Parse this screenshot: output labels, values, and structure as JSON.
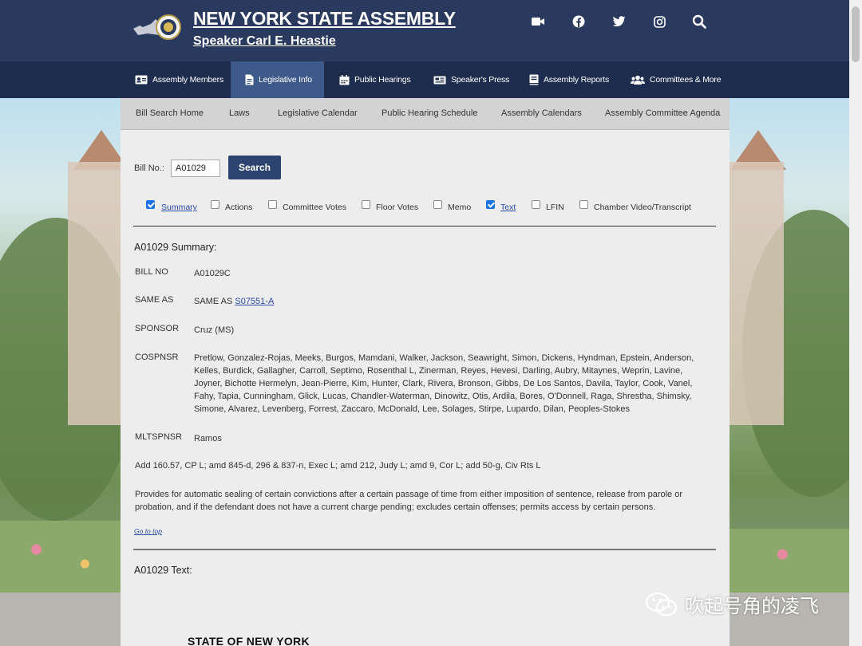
{
  "header": {
    "title": "NEW YORK STATE ASSEMBLY",
    "subtitle": "Speaker Carl E. Heastie",
    "social_icons": [
      "video-icon",
      "facebook-icon",
      "twitter-icon",
      "instagram-icon",
      "search-icon"
    ]
  },
  "nav": {
    "items": [
      {
        "label": "Assembly Members",
        "icon": "id-card-icon"
      },
      {
        "label": "Legislative Info",
        "icon": "document-icon",
        "active": true
      },
      {
        "label": "Public Hearings",
        "icon": "calendar-icon"
      },
      {
        "label": "Speaker's Press",
        "icon": "newspaper-icon"
      },
      {
        "label": "Assembly Reports",
        "icon": "book-icon"
      },
      {
        "label": "Committees & More",
        "icon": "users-icon"
      }
    ]
  },
  "subnav": {
    "items": [
      "Bill Search Home",
      "Laws",
      "Legislative Calendar",
      "Public Hearing Schedule",
      "Assembly Calendars",
      "Assembly Committee Agenda"
    ]
  },
  "search": {
    "label": "Bill No.:",
    "value": "A01029",
    "button": "Search"
  },
  "options": [
    {
      "label": "Summary",
      "checked": true,
      "link": true
    },
    {
      "label": "Actions",
      "checked": false
    },
    {
      "label": "Committee Votes",
      "checked": false
    },
    {
      "label": "Floor Votes",
      "checked": false
    },
    {
      "label": "Memo",
      "checked": false
    },
    {
      "label": "Text",
      "checked": true,
      "link": true
    },
    {
      "label": "LFIN",
      "checked": false
    },
    {
      "label": "Chamber Video/Transcript",
      "checked": false
    }
  ],
  "summary": {
    "heading": "A01029 Summary:",
    "fields": {
      "bill_no_label": "BILL NO",
      "bill_no": "A01029C",
      "same_as_label": "SAME AS",
      "same_as_prefix": "SAME AS",
      "same_as_link": "S07551-A",
      "sponsor_label": "SPONSOR",
      "sponsor": "Cruz (MS)",
      "cosponsor_label": "COSPNSR",
      "cosponsor_lines": [
        "Pretlow, Gonzalez-Rojas, Meeks, Burgos, Mamdani, Walker, Jackson, Seawright, Simon, Dickens, Hyndman, Epstein, Anderson,",
        "Kelles, Burdick, Gallagher, Carroll, Septimo, Rosenthal L, Zinerman, Reyes, Hevesi, Darling, Aubry, Mitaynes, Weprin, Lavine,",
        "Joyner, Bichotte Hermelyn, Jean-Pierre, Kim, Hunter, Clark, Rivera, Bronson, Gibbs, De Los Santos, Davila, Taylor, Cook, Vanel,",
        "Fahy, Tapia, Cunningham, Glick, Lucas, Chandler-Waterman, Dinowitz, Otis, Ardila, Bores, O'Donnell, Raga, Shrestha, Shimsky,",
        "Simone, Alvarez, Levenberg, Forrest, Zaccaro, McDonald, Lee, Solages, Stirpe, Lupardo, Dilan, Peoples-Stokes"
      ],
      "multi_sponsor_label": "MLTSPNSR",
      "multi_sponsor": "Ramos"
    },
    "law_sections": "Add 160.57, CP L; amd 845-d, 296 & 837-n, Exec L; amd 212, Judy L; amd 9, Cor L; add 50-g, Civ Rts L",
    "description_lines": [
      "Provides for automatic sealing of certain convictions after a certain passage of time from either imposition of sentence, release from parole or",
      "probation, and if the defendant does not have a current charge pending; excludes certain offenses; permits access by certain persons."
    ],
    "go_to_top": "Go to top"
  },
  "text_section": {
    "heading": "A01029 Text:",
    "state_title": "STATE OF NEW YORK"
  },
  "watermark": {
    "text": "吹起号角的凌飞"
  }
}
